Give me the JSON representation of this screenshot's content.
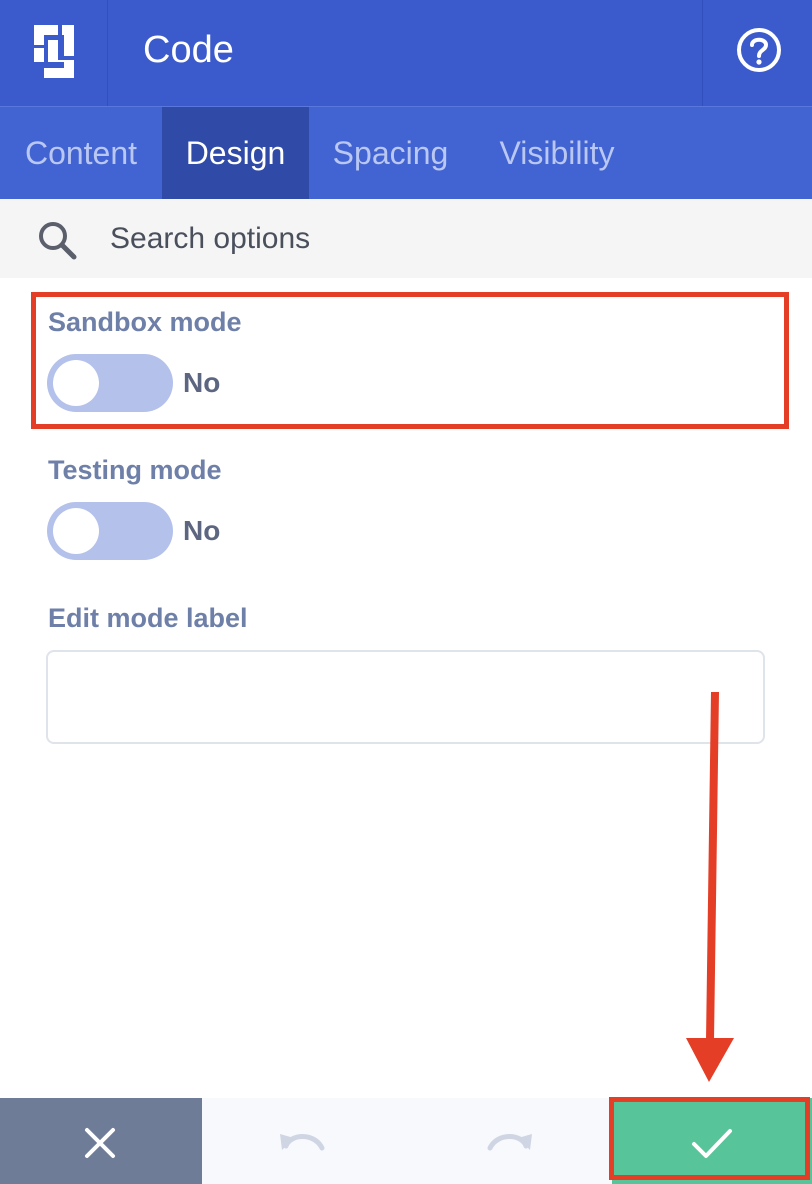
{
  "header": {
    "title": "Code",
    "logo_icon": "builder-logo-icon",
    "help_icon": "help-circle-icon"
  },
  "tabs": [
    {
      "label": "Content",
      "active": false
    },
    {
      "label": "Design",
      "active": true
    },
    {
      "label": "Spacing",
      "active": false
    },
    {
      "label": "Visibility",
      "active": false
    }
  ],
  "search": {
    "placeholder": "Search options",
    "value": ""
  },
  "options": {
    "sandbox": {
      "label": "Sandbox mode",
      "value": "No",
      "enabled": false
    },
    "testing": {
      "label": "Testing mode",
      "value": "No",
      "enabled": false
    },
    "edit_label": {
      "label": "Edit mode label",
      "value": ""
    }
  },
  "footer": {
    "close_icon": "close-icon",
    "undo_icon": "undo-icon",
    "redo_icon": "redo-icon",
    "save_icon": "checkmark-icon"
  },
  "colors": {
    "header": "#3b5bcd",
    "tab_bar": "#4264d3",
    "active_tab": "#2f4aa7",
    "annotation": "#e43e27",
    "save": "#58c49a",
    "close": "#6f7c98"
  }
}
